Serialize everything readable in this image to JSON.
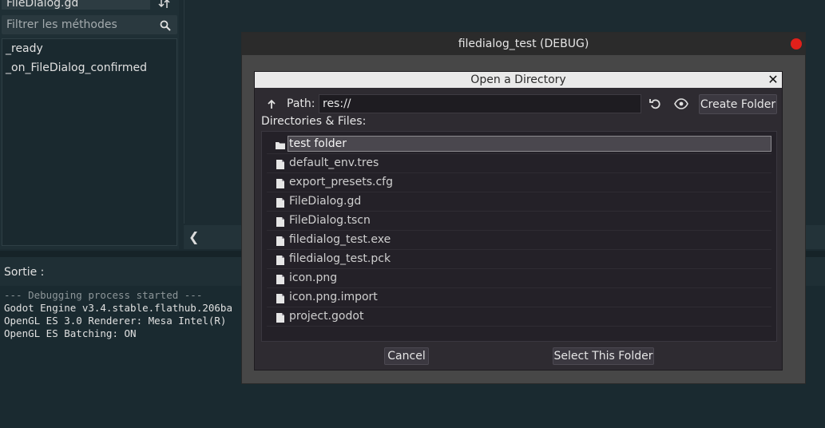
{
  "editor": {
    "file_name": "FileDialog.gd",
    "filter_placeholder": "Filtrer les méthodes",
    "methods": [
      "_ready",
      "_on_FileDialog_confirmed"
    ]
  },
  "output": {
    "title": "Sortie :",
    "lines": [
      "--- Debugging process started ---",
      "Godot Engine v3.4.stable.flathub.206ba",
      "OpenGL ES 3.0 Renderer: Mesa Intel(R)",
      "OpenGL ES Batching: ON"
    ]
  },
  "debug_window": {
    "title": "filedialog_test (DEBUG)"
  },
  "dialog": {
    "title": "Open a Directory",
    "path_label": "Path:",
    "path_value": "res://",
    "create_folder_label": "Create Folder",
    "files_label": "Directories & Files:",
    "items": [
      {
        "name": "test folder",
        "type": "folder",
        "selected": true
      },
      {
        "name": "default_env.tres",
        "type": "file"
      },
      {
        "name": "export_presets.cfg",
        "type": "file"
      },
      {
        "name": "FileDialog.gd",
        "type": "file"
      },
      {
        "name": "FileDialog.tscn",
        "type": "file"
      },
      {
        "name": "filedialog_test.exe",
        "type": "file"
      },
      {
        "name": "filedialog_test.pck",
        "type": "file"
      },
      {
        "name": "icon.png",
        "type": "file"
      },
      {
        "name": "icon.png.import",
        "type": "file"
      },
      {
        "name": "project.godot",
        "type": "file"
      }
    ],
    "cancel_label": "Cancel",
    "select_label": "Select This Folder"
  },
  "colors": {
    "editor_bg": "#1c2b31",
    "dialog_bg": "#2e2b31",
    "debug_close": "#e0201a"
  }
}
